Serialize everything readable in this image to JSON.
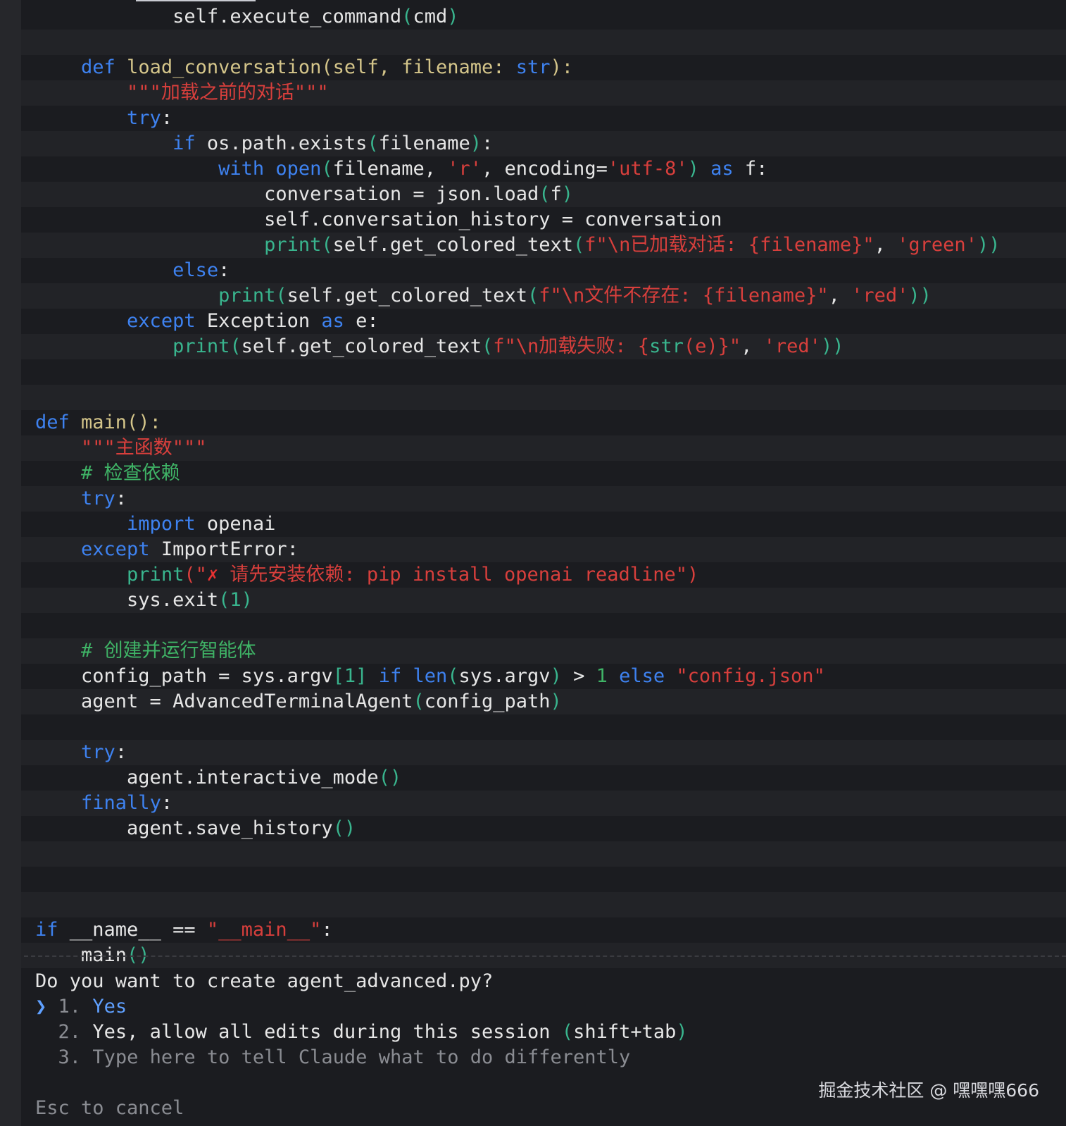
{
  "editor": {
    "lines": [
      {
        "segs": [
          {
            "t": "            self.execute_command"
          },
          {
            "t": "(",
            "c": "paren"
          },
          {
            "t": "cmd"
          },
          {
            "t": ")",
            "c": "paren"
          }
        ]
      },
      {
        "segs": []
      },
      {
        "segs": [
          {
            "t": "    "
          },
          {
            "t": "def ",
            "c": "kw"
          },
          {
            "t": "load_conversation(self, filename: ",
            "c": "fn"
          },
          {
            "t": "str",
            "c": "kw"
          },
          {
            "t": "):",
            "c": "fn"
          }
        ]
      },
      {
        "segs": [
          {
            "t": "        "
          },
          {
            "t": "\"\"\"加载之前的对话\"\"\"",
            "c": "str"
          }
        ]
      },
      {
        "segs": [
          {
            "t": "        "
          },
          {
            "t": "try",
            "c": "kw"
          },
          {
            "t": ":"
          }
        ]
      },
      {
        "segs": [
          {
            "t": "            "
          },
          {
            "t": "if ",
            "c": "kw"
          },
          {
            "t": "os.path.exists"
          },
          {
            "t": "(",
            "c": "paren"
          },
          {
            "t": "filename"
          },
          {
            "t": ")",
            "c": "paren"
          },
          {
            "t": ":"
          }
        ]
      },
      {
        "segs": [
          {
            "t": "                "
          },
          {
            "t": "with ",
            "c": "kw"
          },
          {
            "t": "open",
            "c": "kw"
          },
          {
            "t": "(",
            "c": "paren"
          },
          {
            "t": "filename, "
          },
          {
            "t": "'r'",
            "c": "str"
          },
          {
            "t": ", encoding="
          },
          {
            "t": "'utf-8'",
            "c": "str"
          },
          {
            "t": ")",
            "c": "paren"
          },
          {
            "t": " "
          },
          {
            "t": "as",
            "c": "kw"
          },
          {
            "t": " f:"
          }
        ]
      },
      {
        "segs": [
          {
            "t": "                    conversation = json.load"
          },
          {
            "t": "(",
            "c": "paren"
          },
          {
            "t": "f"
          },
          {
            "t": ")",
            "c": "paren"
          }
        ]
      },
      {
        "segs": [
          {
            "t": "                    self.conversation_history = conversation"
          }
        ]
      },
      {
        "segs": [
          {
            "t": "                    "
          },
          {
            "t": "print",
            "c": "paren"
          },
          {
            "t": "(",
            "c": "paren"
          },
          {
            "t": "self.get_colored_text"
          },
          {
            "t": "(",
            "c": "paren"
          },
          {
            "t": "f\"\\n已加载对话: {filename}\"",
            "c": "str"
          },
          {
            "t": ", "
          },
          {
            "t": "'green'",
            "c": "str"
          },
          {
            "t": "))",
            "c": "paren"
          }
        ]
      },
      {
        "segs": [
          {
            "t": "            "
          },
          {
            "t": "else",
            "c": "kw"
          },
          {
            "t": ":"
          }
        ]
      },
      {
        "segs": [
          {
            "t": "                "
          },
          {
            "t": "print",
            "c": "paren"
          },
          {
            "t": "(",
            "c": "paren"
          },
          {
            "t": "self.get_colored_text"
          },
          {
            "t": "(",
            "c": "paren"
          },
          {
            "t": "f\"\\n文件不存在: {filename}\"",
            "c": "str"
          },
          {
            "t": ", "
          },
          {
            "t": "'red'",
            "c": "str"
          },
          {
            "t": "))",
            "c": "paren"
          }
        ]
      },
      {
        "segs": [
          {
            "t": "        "
          },
          {
            "t": "except ",
            "c": "kw"
          },
          {
            "t": "Exception "
          },
          {
            "t": "as",
            "c": "kw"
          },
          {
            "t": " e:"
          }
        ]
      },
      {
        "segs": [
          {
            "t": "            "
          },
          {
            "t": "print",
            "c": "paren"
          },
          {
            "t": "(",
            "c": "paren"
          },
          {
            "t": "self.get_colored_text"
          },
          {
            "t": "(",
            "c": "paren"
          },
          {
            "t": "f\"\\n加载失败: {",
            "c": "str"
          },
          {
            "t": "str",
            "c": "paren"
          },
          {
            "t": "(e)",
            "c": "str"
          },
          {
            "t": "}\"",
            "c": "str"
          },
          {
            "t": ", "
          },
          {
            "t": "'red'",
            "c": "str"
          },
          {
            "t": "))",
            "c": "paren"
          }
        ]
      },
      {
        "segs": []
      },
      {
        "segs": []
      },
      {
        "segs": [
          {
            "t": "def ",
            "c": "kw"
          },
          {
            "t": "main():",
            "c": "fn"
          }
        ]
      },
      {
        "segs": [
          {
            "t": "    "
          },
          {
            "t": "\"\"\"主函数\"\"\"",
            "c": "str"
          }
        ]
      },
      {
        "segs": [
          {
            "t": "    "
          },
          {
            "t": "# 检查依赖",
            "c": "com"
          }
        ]
      },
      {
        "segs": [
          {
            "t": "    "
          },
          {
            "t": "try",
            "c": "kw"
          },
          {
            "t": ":"
          }
        ]
      },
      {
        "segs": [
          {
            "t": "        "
          },
          {
            "t": "import ",
            "c": "kw"
          },
          {
            "t": "openai"
          }
        ]
      },
      {
        "segs": [
          {
            "t": "    "
          },
          {
            "t": "except ",
            "c": "kw"
          },
          {
            "t": "ImportError:"
          }
        ]
      },
      {
        "segs": [
          {
            "t": "        "
          },
          {
            "t": "print",
            "c": "paren"
          },
          {
            "t": "(\"",
            "c": "str"
          },
          {
            "t": "✗",
            "c": "cross"
          },
          {
            "t": " 请先安装依赖: pip install openai readline\"",
            "c": "str"
          },
          {
            "t": ")",
            "c": "str"
          }
        ]
      },
      {
        "segs": [
          {
            "t": "        sys.exit"
          },
          {
            "t": "(1)",
            "c": "paren"
          }
        ]
      },
      {
        "segs": []
      },
      {
        "segs": [
          {
            "t": "    "
          },
          {
            "t": "# 创建并运行智能体",
            "c": "com"
          }
        ]
      },
      {
        "segs": [
          {
            "t": "    config_path = sys.argv"
          },
          {
            "t": "[1]",
            "c": "paren"
          },
          {
            "t": " "
          },
          {
            "t": "if ",
            "c": "kw"
          },
          {
            "t": "len",
            "c": "kw"
          },
          {
            "t": "(",
            "c": "paren"
          },
          {
            "t": "sys.argv"
          },
          {
            "t": ")",
            "c": "paren"
          },
          {
            "t": " > "
          },
          {
            "t": "1",
            "c": "num"
          },
          {
            "t": " "
          },
          {
            "t": "else ",
            "c": "kw"
          },
          {
            "t": "\"config.json\"",
            "c": "str"
          }
        ]
      },
      {
        "segs": [
          {
            "t": "    agent = AdvancedTerminalAgent"
          },
          {
            "t": "(",
            "c": "paren"
          },
          {
            "t": "config_path"
          },
          {
            "t": ")",
            "c": "paren"
          }
        ]
      },
      {
        "segs": []
      },
      {
        "segs": [
          {
            "t": "    "
          },
          {
            "t": "try",
            "c": "kw"
          },
          {
            "t": ":"
          }
        ]
      },
      {
        "segs": [
          {
            "t": "        agent.interactive_mode"
          },
          {
            "t": "()",
            "c": "paren"
          }
        ]
      },
      {
        "segs": [
          {
            "t": "    "
          },
          {
            "t": "finally",
            "c": "kw"
          },
          {
            "t": ":"
          }
        ]
      },
      {
        "segs": [
          {
            "t": "        agent.save_history"
          },
          {
            "t": "()",
            "c": "paren"
          }
        ]
      },
      {
        "segs": []
      },
      {
        "segs": []
      },
      {
        "segs": []
      },
      {
        "segs": [
          {
            "t": "if ",
            "c": "kw"
          },
          {
            "t": "__name__ == "
          },
          {
            "t": "\"__main__\"",
            "c": "str"
          },
          {
            "t": ":"
          }
        ]
      },
      {
        "segs": [
          {
            "t": "    main"
          },
          {
            "t": "()",
            "c": "paren"
          }
        ]
      }
    ]
  },
  "prompt": {
    "question": "Do you want to create agent_advanced.py?",
    "options": [
      {
        "marker": "❯",
        "number": "1.",
        "label": "Yes"
      },
      {
        "marker": " ",
        "number": "2.",
        "label": "Yes, allow all edits during this session",
        "hint": "shift+tab"
      },
      {
        "marker": " ",
        "number": "3.",
        "label": "Type here to tell Claude what to do differently"
      }
    ],
    "cancel_hint": "Esc to cancel"
  },
  "watermark": "掘金技术社区 @ 嘿嘿嘿666"
}
